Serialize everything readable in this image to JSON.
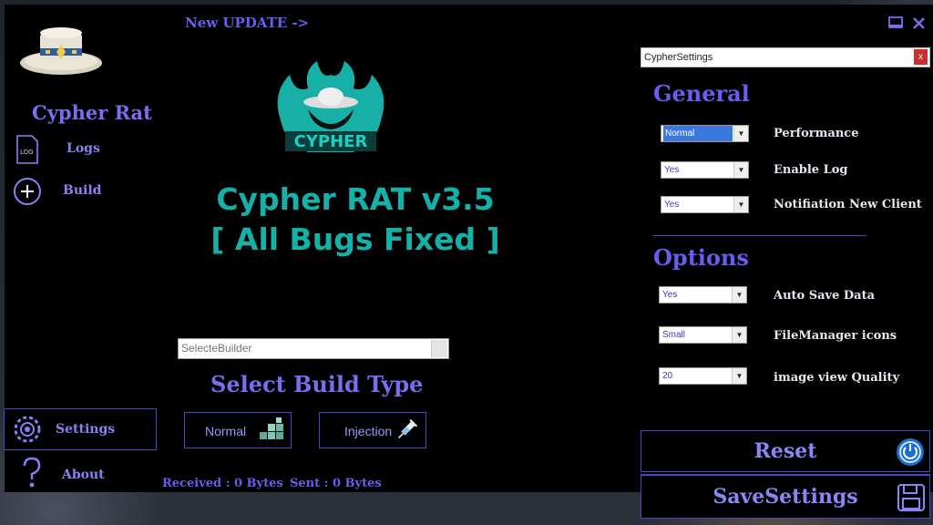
{
  "header": {
    "new_update": "New UPDATE ->"
  },
  "sidebar": {
    "title": "Cypher Rat",
    "items": [
      {
        "label": "Logs",
        "icon": "log-file-icon"
      },
      {
        "label": "Build",
        "icon": "plus-circle-icon"
      }
    ],
    "bottom_items": [
      {
        "label": "Settings",
        "icon": "gear-icon"
      },
      {
        "label": "About",
        "icon": "question-icon"
      }
    ],
    "logo": {
      "icon": "hat-logo-icon"
    }
  },
  "main": {
    "logo_text": "CYPHER",
    "banner_line1": "Cypher RAT v3.5",
    "banner_line2": "[ All Bugs Fixed ]",
    "builder_select_placeholder": "SelecteBuilder",
    "build_type_title": "Select Build Type",
    "build_buttons": [
      {
        "label": "Normal",
        "icon": "blocks-icon"
      },
      {
        "label": "Injection",
        "icon": "syringe-icon"
      }
    ],
    "received": "Received : 0 Bytes",
    "sent": "Sent : 0 Bytes"
  },
  "window_controls": {
    "minimize_icon": "window-icon",
    "close_icon": "x-icon"
  },
  "settings_panel": {
    "title": "CypherSettings",
    "close_label": "x",
    "general_heading": "General",
    "options_heading": "Options",
    "general": [
      {
        "label": "Performance",
        "value": "Normal"
      },
      {
        "label": "Enable Log",
        "value": "Yes"
      },
      {
        "label": "Notifiation New Client",
        "value": "Yes"
      }
    ],
    "options": [
      {
        "label": "Auto Save Data",
        "value": "Yes"
      },
      {
        "label": "FileManager icons",
        "value": "Small"
      },
      {
        "label": "image view Quality",
        "value": "20"
      }
    ],
    "reset_label": "Reset",
    "save_label": "SaveSettings"
  },
  "colors": {
    "accent": "#6a5cf0",
    "banner": "#14b1a8",
    "border": "#4d42c8",
    "background": "#000000"
  }
}
